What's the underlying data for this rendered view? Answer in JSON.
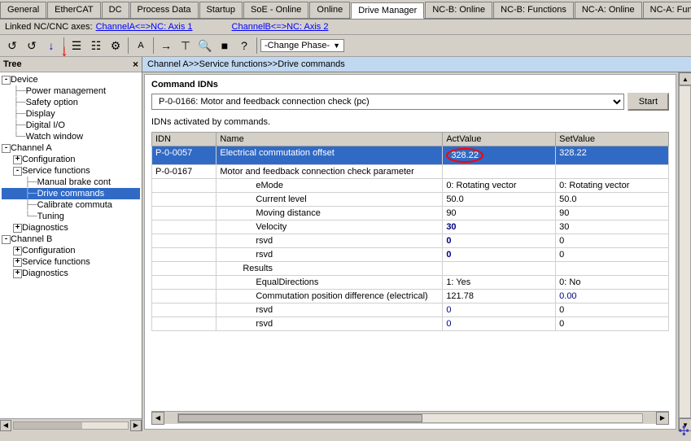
{
  "tabs": [
    {
      "id": "general",
      "label": "General"
    },
    {
      "id": "ethercat",
      "label": "EtherCAT"
    },
    {
      "id": "dc",
      "label": "DC"
    },
    {
      "id": "process-data",
      "label": "Process Data"
    },
    {
      "id": "startup",
      "label": "Startup"
    },
    {
      "id": "soe-online",
      "label": "SoE - Online"
    },
    {
      "id": "online",
      "label": "Online"
    },
    {
      "id": "drive-manager",
      "label": "Drive Manager"
    },
    {
      "id": "nc-b-online",
      "label": "NC-B: Online"
    },
    {
      "id": "nc-b-functions",
      "label": "NC-B: Functions"
    },
    {
      "id": "nc-a-online",
      "label": "NC-A: Online"
    },
    {
      "id": "nc-a-functions",
      "label": "NC-A: Functions"
    }
  ],
  "linked_bar": {
    "label": "Linked NC/CNC axes:",
    "channel_a": "ChannelA<=>NC: Axis 1",
    "channel_b": "ChannelB<=>NC: Axis 2"
  },
  "toolbar": {
    "dropdown_label": "-Change Phase-",
    "dropdown_arrow": "▼"
  },
  "tree": {
    "header": "Tree",
    "close": "×",
    "items": [
      {
        "id": "device",
        "label": "Device",
        "level": 0,
        "expander": "-",
        "icon": "📁"
      },
      {
        "id": "power-mgmt",
        "label": "Power management",
        "level": 1,
        "expander": null,
        "connector": "├"
      },
      {
        "id": "safety-option",
        "label": "Safety option",
        "level": 1,
        "expander": null,
        "connector": "├"
      },
      {
        "id": "display",
        "label": "Display",
        "level": 1,
        "expander": null,
        "connector": "├"
      },
      {
        "id": "digital-io",
        "label": "Digital I/O",
        "level": 1,
        "expander": null,
        "connector": "├"
      },
      {
        "id": "watch-window",
        "label": "Watch window",
        "level": 1,
        "expander": null,
        "connector": "└"
      },
      {
        "id": "channel-a",
        "label": "Channel A",
        "level": 0,
        "expander": "-",
        "icon": "📁"
      },
      {
        "id": "configuration-a",
        "label": "Configuration",
        "level": 1,
        "expander": "+",
        "connector": "├"
      },
      {
        "id": "service-functions-a",
        "label": "Service functions",
        "level": 1,
        "expander": "-",
        "connector": "├"
      },
      {
        "id": "manual-brake",
        "label": "Manual brake cont",
        "level": 2,
        "connector": "├"
      },
      {
        "id": "drive-commands",
        "label": "Drive commands",
        "level": 2,
        "connector": "├",
        "selected": true
      },
      {
        "id": "calibrate",
        "label": "Calibrate commuta",
        "level": 2,
        "connector": "├"
      },
      {
        "id": "tuning",
        "label": "Tuning",
        "level": 2,
        "connector": "└"
      },
      {
        "id": "diagnostics-a",
        "label": "Diagnostics",
        "level": 1,
        "expander": "+",
        "connector": "└"
      },
      {
        "id": "channel-b",
        "label": "Channel B",
        "level": 0,
        "expander": "-",
        "icon": "📁"
      },
      {
        "id": "configuration-b",
        "label": "Configuration",
        "level": 1,
        "expander": "+",
        "connector": "├"
      },
      {
        "id": "service-functions-b",
        "label": "Service functions",
        "level": 1,
        "expander": "+",
        "connector": "├"
      },
      {
        "id": "diagnostics-b",
        "label": "Diagnostics",
        "level": 1,
        "expander": "+",
        "connector": "└"
      }
    ]
  },
  "breadcrumb": "Channel A>>Service functions>>Drive commands",
  "command_idns": {
    "label": "Command IDNs",
    "dropdown_value": "P-0-0166: Motor and feedback connection check (pc)",
    "start_button": "Start"
  },
  "idn_label": "IDNs activated by commands.",
  "table": {
    "headers": [
      "IDN",
      "Name",
      "ActValue",
      "SetValue"
    ],
    "rows": [
      {
        "idn": "P-0-0057",
        "name": "Electrical commutation offset",
        "act_value": "328.22",
        "set_value": "328.22",
        "selected": true,
        "highlighted_act": true,
        "level": 0
      },
      {
        "idn": "P-0-0167",
        "name": "Motor and feedback connection check parameter",
        "act_value": "",
        "set_value": "",
        "selected": false,
        "level": 0,
        "group_header": true
      },
      {
        "idn": "",
        "name": "eMode",
        "act_value": "0: Rotating vector",
        "set_value": "0: Rotating vector",
        "selected": false,
        "level": 2
      },
      {
        "idn": "",
        "name": "Current level",
        "act_value": "50.0",
        "set_value": "50.0",
        "selected": false,
        "level": 2
      },
      {
        "idn": "",
        "name": "Moving distance",
        "act_value": "90",
        "set_value": "90",
        "selected": false,
        "level": 2
      },
      {
        "idn": "",
        "name": "Velocity",
        "act_value": "30",
        "set_value": "30",
        "selected": false,
        "level": 2,
        "bold_act": true
      },
      {
        "idn": "",
        "name": "rsvd",
        "act_value": "0",
        "set_value": "0",
        "selected": false,
        "level": 2,
        "bold_act": true
      },
      {
        "idn": "",
        "name": "rsvd",
        "act_value": "0",
        "set_value": "0",
        "selected": false,
        "level": 2,
        "bold_act": true
      },
      {
        "idn": "",
        "name": "Results",
        "act_value": "",
        "set_value": "",
        "selected": false,
        "level": 1,
        "group_header": true
      },
      {
        "idn": "",
        "name": "EqualDirections",
        "act_value": "1: Yes",
        "set_value": "0: No",
        "selected": false,
        "level": 2
      },
      {
        "idn": "",
        "name": "Commutation position difference (electrical)",
        "act_value": "121.78",
        "set_value": "0.00",
        "selected": false,
        "level": 2
      },
      {
        "idn": "",
        "name": "rsvd",
        "act_value": "0",
        "set_value": "0",
        "selected": false,
        "level": 2,
        "bold_act": true
      },
      {
        "idn": "",
        "name": "rsvd",
        "act_value": "0",
        "set_value": "0",
        "selected": false,
        "level": 2,
        "bold_act": true
      }
    ]
  }
}
